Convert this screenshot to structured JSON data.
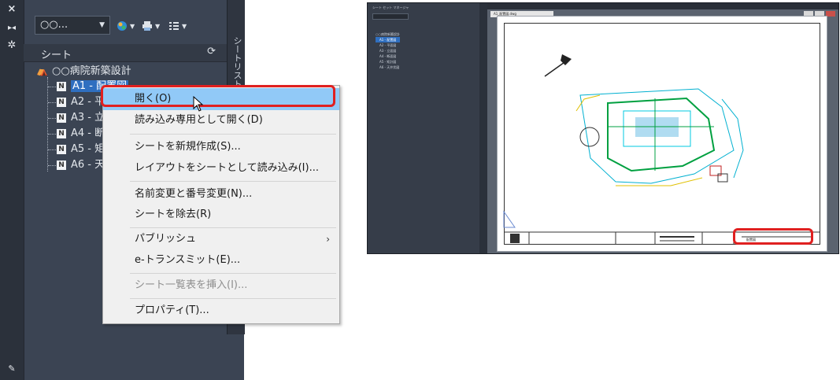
{
  "left_panel": {
    "strip": {
      "close_icon": "×",
      "collapse_icon": "▸◂",
      "settings_icon": "✲",
      "bottom_icon": "✎"
    },
    "side_tab_label": "シートリストマネージャ",
    "toolbar": {
      "sheetset_value": "○○...",
      "chevron": "▼"
    },
    "section": {
      "title": "シート",
      "refresh_icon": "⟳"
    },
    "tree": {
      "root_label": "○○病院新築設計",
      "items": [
        {
          "label": "A1 - 配置図"
        },
        {
          "label": "A2 - 平"
        },
        {
          "label": "A3 - 立"
        },
        {
          "label": "A4 - 断"
        },
        {
          "label": "A5 - 矩"
        },
        {
          "label": "A6 - 天"
        }
      ]
    }
  },
  "context_menu": {
    "items": [
      {
        "label": "開く(O)",
        "highlighted": true
      },
      {
        "label": "読み込み専用として開く(D)"
      },
      {
        "label": "シートを新規作成(S)..."
      },
      {
        "label": "レイアウトをシートとして読み込み(I)..."
      },
      {
        "label": "名前変更と番号変更(N)..."
      },
      {
        "label": "シートを除去(R)"
      },
      {
        "label": "パブリッシュ",
        "submenu_arrow": "›"
      },
      {
        "label": "e-トランスミット(E)..."
      },
      {
        "label": "シート一覧表を挿入(I)...",
        "disabled": true
      },
      {
        "label": "プロパティ(T)..."
      }
    ]
  },
  "thumbnail": {
    "panel_title": "シート セット マネージャ",
    "tab_label": "A1_配置図.dwg",
    "tree_items": [
      "○○病院新築設計",
      "A1 - 配置図",
      "A2 - 平面図",
      "A3 - 立面図",
      "A4 - 断面図",
      "A5 - 矩計図",
      "A6 - 天井伏図"
    ],
    "titleblock_name": "配置図"
  },
  "colors": {
    "accent_highlight": "#91c9f7",
    "callout_red": "#e02020",
    "panel_bg": "#3b4453",
    "selection_blue": "#2f6fc0"
  }
}
